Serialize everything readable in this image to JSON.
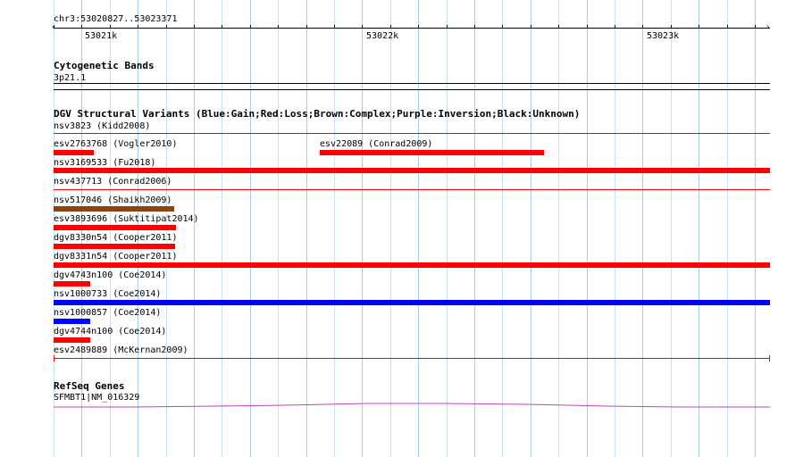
{
  "ruler": {
    "position": "chr3:53020827..53023371",
    "ticks": [
      {
        "label": "53021k"
      },
      {
        "label": "53022k"
      },
      {
        "label": "53023k"
      }
    ]
  },
  "cytoband": {
    "title": "Cytogenetic Bands",
    "band": "3p21.1"
  },
  "dgv": {
    "title": "DGV Structural Variants (Blue:Gain;Red:Loss;Brown:Complex;Purple:Inversion;Black:Unknown)",
    "colors": {
      "gain": "#0000ff",
      "loss": "#ff0000",
      "complex": "#8b4513",
      "inversion": "#800080",
      "unknown": "#000000"
    },
    "features": [
      {
        "label": "nsv3823 (Kidd2008)",
        "type": "loss"
      },
      {
        "label": "esv2763768 (Vogler2010)",
        "type": "loss"
      },
      {
        "label": "esv22089 (Conrad2009)",
        "type": "loss"
      },
      {
        "label": "nsv3169533 (Fu2018)",
        "type": "loss"
      },
      {
        "label": "nsv437713 (Conrad2006)",
        "type": "loss"
      },
      {
        "label": "nsv517046 (Shaikh2009)",
        "type": "complex"
      },
      {
        "label": "esv3893696 (Suktitipat2014)",
        "type": "loss"
      },
      {
        "label": "dgv8330n54 (Cooper2011)",
        "type": "loss"
      },
      {
        "label": "dgv8331n54 (Cooper2011)",
        "type": "loss"
      },
      {
        "label": "dgv4743n100 (Coe2014)",
        "type": "loss"
      },
      {
        "label": "nsv1000733 (Coe2014)",
        "type": "gain"
      },
      {
        "label": "nsv1000857 (Coe2014)",
        "type": "gain"
      },
      {
        "label": "dgv4744n100 (Coe2014)",
        "type": "loss"
      },
      {
        "label": "esv2489889 (McKernan2009)",
        "type": "loss"
      }
    ]
  },
  "refseq": {
    "title": "RefSeq Genes",
    "gene": "SFMBT1|NM_016329",
    "color": "#c040c0"
  }
}
